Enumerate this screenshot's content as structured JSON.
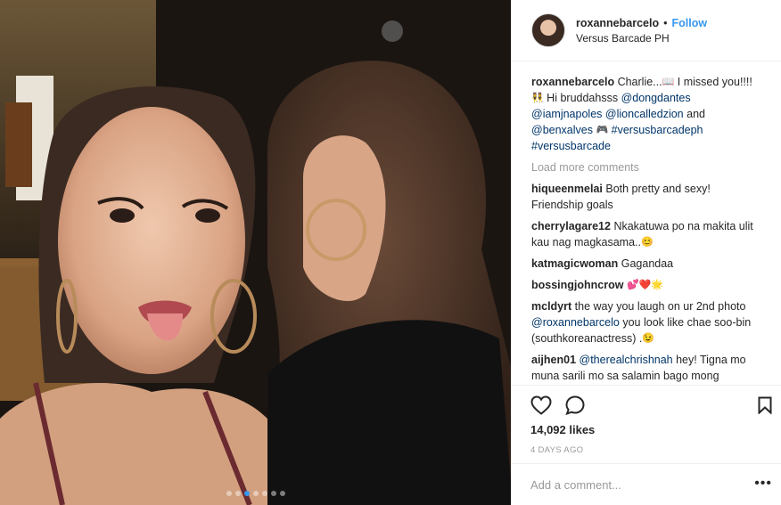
{
  "post": {
    "username": "roxannebarcelo",
    "separator": "•",
    "follow_label": "Follow",
    "location": "Versus Barcade PH",
    "carousel": {
      "count": 7,
      "active_index": 2
    }
  },
  "caption": {
    "username": "roxannebarcelo",
    "parts": [
      {
        "t": "text",
        "v": "Charlie..."
      },
      {
        "t": "emoji",
        "v": "📖"
      },
      {
        "t": "text",
        "v": " I missed you!!!! "
      },
      {
        "t": "emoji",
        "v": "👯"
      },
      {
        "t": "text",
        "v": " Hi bruddahsss "
      },
      {
        "t": "mention",
        "v": "@dongdantes"
      },
      {
        "t": "text",
        "v": " "
      },
      {
        "t": "mention",
        "v": "@iamjnapoles"
      },
      {
        "t": "text",
        "v": " "
      },
      {
        "t": "mention",
        "v": "@lioncalledzion"
      },
      {
        "t": "text",
        "v": " and "
      },
      {
        "t": "mention",
        "v": "@benxalves"
      },
      {
        "t": "text",
        "v": " "
      },
      {
        "t": "emoji",
        "v": "🎮"
      },
      {
        "t": "text",
        "v": " "
      },
      {
        "t": "mention",
        "v": "#versusbarcadeph"
      },
      {
        "t": "text",
        "v": " "
      },
      {
        "t": "mention",
        "v": "#versusbarcade"
      }
    ]
  },
  "load_more_label": "Load more comments",
  "comments": [
    {
      "user": "hiqueenmelai",
      "parts": [
        {
          "t": "text",
          "v": "Both pretty and sexy! Friendship goals"
        }
      ]
    },
    {
      "user": "cherrylagare12",
      "parts": [
        {
          "t": "text",
          "v": "Nkakatuwa po na makita ulit kau nag magkasama.."
        },
        {
          "t": "emoji",
          "v": "😊"
        }
      ]
    },
    {
      "user": "katmagicwoman",
      "parts": [
        {
          "t": "text",
          "v": "Gagandaa"
        }
      ]
    },
    {
      "user": "bossingjohncrow",
      "parts": [
        {
          "t": "emoji",
          "v": "💕❤️🌟"
        }
      ]
    },
    {
      "user": "mcldyrt",
      "parts": [
        {
          "t": "text",
          "v": "the way you laugh on ur 2nd photo "
        },
        {
          "t": "mention",
          "v": "@roxannebarcelo"
        },
        {
          "t": "text",
          "v": " you look like chae soo-bin (southkoreanactress) ."
        },
        {
          "t": "emoji",
          "v": "😉"
        }
      ]
    },
    {
      "user": "aijhen01",
      "parts": [
        {
          "t": "mention",
          "v": "@therealchrishnah"
        },
        {
          "t": "text",
          "v": " hey! Tigna mo muna sarili mo sa salamin bago mong sabihing prang plaspag si natalie. Look at"
        }
      ]
    }
  ],
  "likes": "14,092 likes",
  "time": "4 DAYS AGO",
  "add_comment_placeholder": "Add a comment...",
  "more_options": "•••",
  "colors": {
    "accent": "#3897f0",
    "mention": "#003569",
    "muted": "#999999",
    "text": "#262626"
  },
  "icons": [
    "heart-icon",
    "comment-icon",
    "bookmark-icon",
    "more-options-icon"
  ]
}
